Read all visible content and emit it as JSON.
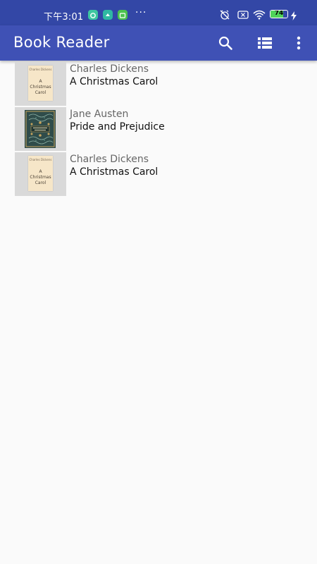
{
  "status_bar": {
    "time": "下午3:01",
    "battery_level": "74",
    "battery_fraction": 0.74,
    "overflow": "···",
    "background": "#3347a6"
  },
  "app_bar": {
    "title": "Book Reader",
    "actions": [
      "search-icon",
      "view-list-icon",
      "more-vert-icon"
    ],
    "background": "#3f51b5"
  },
  "books": [
    {
      "author": "Charles Dickens",
      "title": "A Christmas Carol",
      "cover_author": "Charles Dickens",
      "cover_title": "A Christmas Carol"
    },
    {
      "author": "Jane Austen",
      "title": "Pride and Prejudice"
    },
    {
      "author": "Charles Dickens",
      "title": "A Christmas Carol",
      "cover_author": "Charles Dickens",
      "cover_title": "A Christmas Carol"
    }
  ]
}
